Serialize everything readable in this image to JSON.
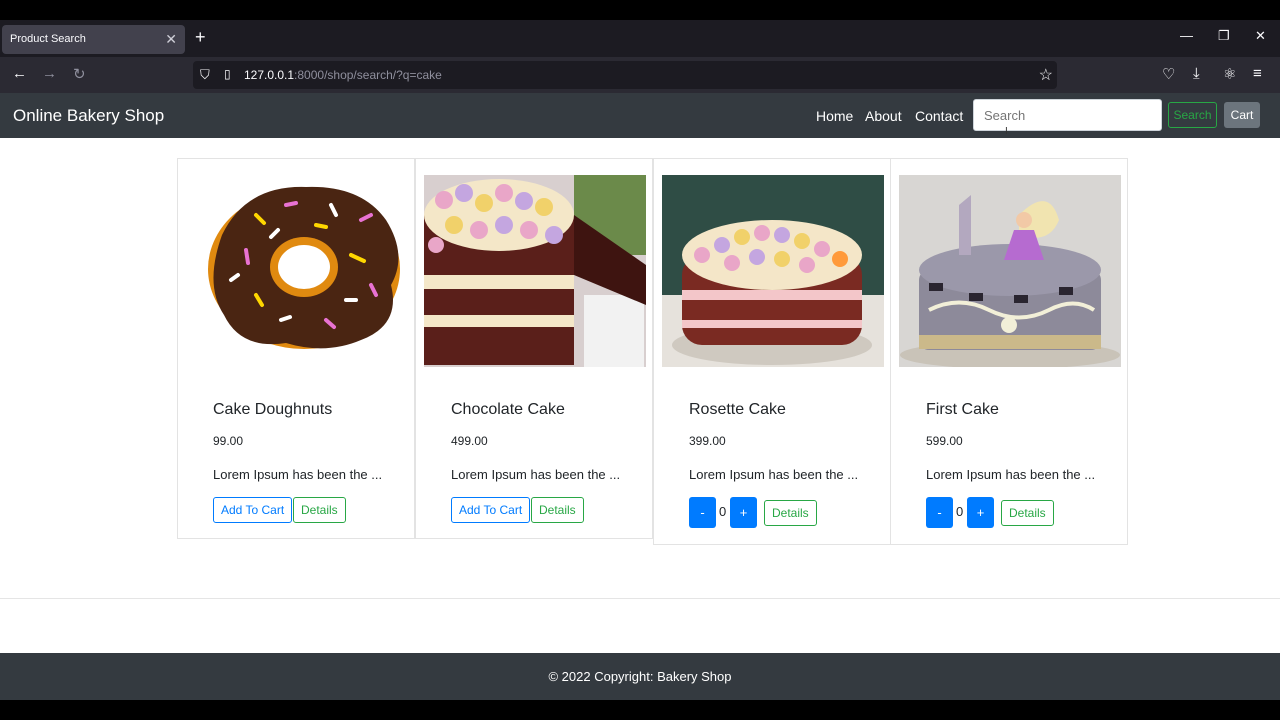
{
  "browser": {
    "tab_title": "Product Search",
    "new_tab": "+",
    "url_host": "127.0.0.1",
    "url_rest": ":8000/shop/search/?q=cake"
  },
  "site": {
    "brand": "Online Bakery Shop",
    "nav": [
      "Home",
      "About",
      "Contact"
    ],
    "search_placeholder": "Search",
    "search_button": "Search",
    "cart_button": "Cart"
  },
  "products": [
    {
      "title": "Cake Doughnuts",
      "price": "99.00",
      "desc": "Lorem Ipsum has been the ...",
      "add_to_cart": "Add To Cart",
      "details": "Details"
    },
    {
      "title": "Chocolate Cake",
      "price": "499.00",
      "desc": "Lorem Ipsum has been the ...",
      "add_to_cart": "Add To Cart",
      "details": "Details"
    },
    {
      "title": "Rosette Cake",
      "price": "399.00",
      "desc": "Lorem Ipsum has been the ...",
      "minus": "-",
      "qty": "0",
      "plus": "+",
      "details": "Details"
    },
    {
      "title": "First Cake",
      "price": "599.00",
      "desc": "Lorem Ipsum has been the ...",
      "minus": "-",
      "qty": "0",
      "plus": "+",
      "details": "Details"
    }
  ],
  "footer": {
    "text": "© 2022 Copyright: Bakery Shop"
  },
  "colors": {
    "navbar": "#343a40",
    "primary": "#007bff",
    "success": "#28a745"
  }
}
